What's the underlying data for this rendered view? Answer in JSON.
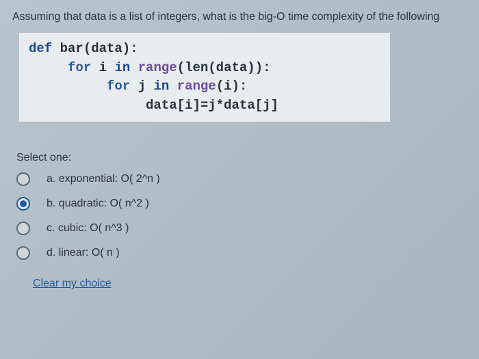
{
  "question": "Assuming that data is a list of integers, what is the big-O time complexity of the following",
  "code": {
    "line1_def": "def ",
    "line1_rest": "bar(data):",
    "line2_for": "for ",
    "line2_var": "i ",
    "line2_in": "in ",
    "line2_range": "range",
    "line2_rest": "(len(data)):",
    "line3_for": "for ",
    "line3_var": "j ",
    "line3_in": "in ",
    "line3_range": "range",
    "line3_rest": "(i):",
    "line4": "data[i]=j*data[j]"
  },
  "prompt": "Select one:",
  "options": [
    {
      "label": "a. exponential: O( 2^n )",
      "selected": false
    },
    {
      "label": "b. quadratic: O( n^2 )",
      "selected": true
    },
    {
      "label": "c. cubic: O( n^3 )",
      "selected": false
    },
    {
      "label": "d. linear: O( n )",
      "selected": false
    }
  ],
  "clear": "Clear my choice"
}
